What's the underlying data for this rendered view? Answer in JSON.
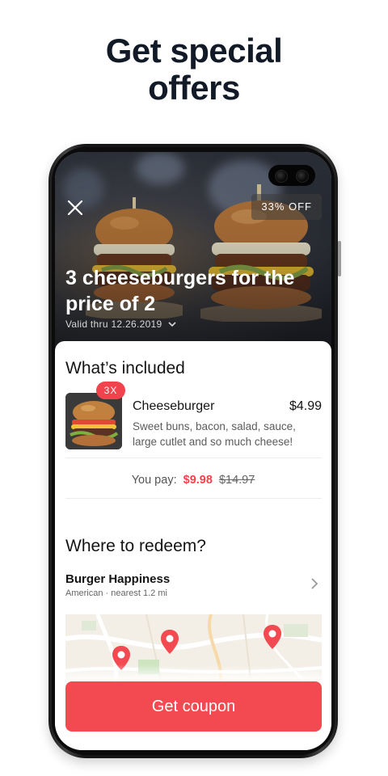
{
  "promo": {
    "headline_line1": "Get special",
    "headline_line2": "offers"
  },
  "offer": {
    "discount_badge": "33% OFF",
    "title": "3 cheeseburgers for the price of 2",
    "valid_text": "Valid thru 12.26.2019"
  },
  "included": {
    "heading": "What’s included",
    "item": {
      "qty_badge": "3X",
      "name": "Cheeseburger",
      "price": "$4.99",
      "description": "Sweet buns, bacon, salad, sauce, large cutlet and so much cheese!"
    },
    "pay_label": "You pay:",
    "pay_now": "$9.98",
    "pay_was": "$14.97"
  },
  "redeem": {
    "heading": "Where to redeem?",
    "place_name": "Burger Happiness",
    "place_sub": "American · nearest 1.2 mi"
  },
  "cta": {
    "label": "Get coupon"
  },
  "colors": {
    "accent": "#f24a50",
    "headline": "#111a26"
  },
  "icons": {
    "close": "close-icon",
    "valid_expand": "chevron-down-icon",
    "place_open": "chevron-right-icon",
    "map_pin": "map-pin-icon"
  }
}
